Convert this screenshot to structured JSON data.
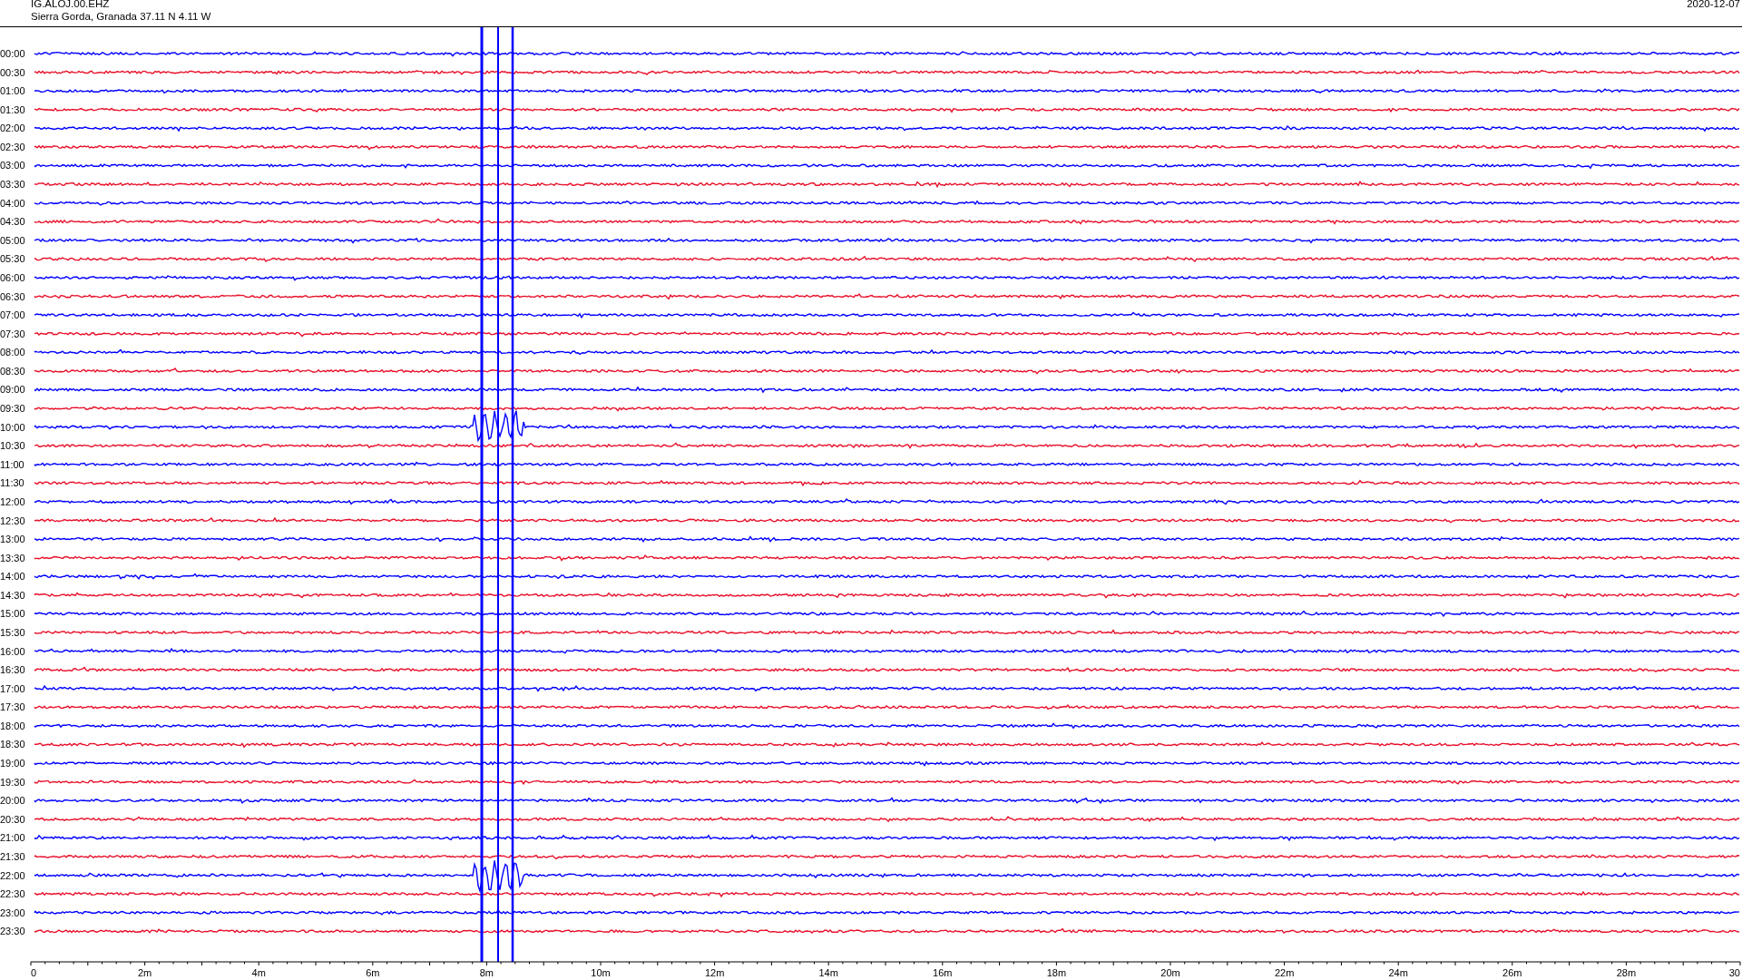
{
  "header": {
    "station": "IG.ALOJ.00.EHZ",
    "location": "Sierra Gorda, Granada  37.11 N 4.11 W",
    "date": "2020-12-07"
  },
  "rows": [
    {
      "time": "00:00",
      "color": "#0000ff"
    },
    {
      "time": "00:30",
      "color": "#e8102a"
    },
    {
      "time": "01:00",
      "color": "#0000ff"
    },
    {
      "time": "01:30",
      "color": "#e8102a"
    },
    {
      "time": "02:00",
      "color": "#0000ff"
    },
    {
      "time": "02:30",
      "color": "#e8102a"
    },
    {
      "time": "03:00",
      "color": "#0000ff"
    },
    {
      "time": "03:30",
      "color": "#e8102a"
    },
    {
      "time": "04:00",
      "color": "#0000ff"
    },
    {
      "time": "04:30",
      "color": "#e8102a"
    },
    {
      "time": "05:00",
      "color": "#0000ff"
    },
    {
      "time": "05:30",
      "color": "#e8102a"
    },
    {
      "time": "06:00",
      "color": "#0000ff"
    },
    {
      "time": "06:30",
      "color": "#e8102a"
    },
    {
      "time": "07:00",
      "color": "#0000ff"
    },
    {
      "time": "07:30",
      "color": "#e8102a"
    },
    {
      "time": "08:00",
      "color": "#0000ff"
    },
    {
      "time": "08:30",
      "color": "#e8102a"
    },
    {
      "time": "09:00",
      "color": "#0000ff"
    },
    {
      "time": "09:30",
      "color": "#e8102a"
    },
    {
      "time": "10:00",
      "color": "#0000ff"
    },
    {
      "time": "10:30",
      "color": "#e8102a"
    },
    {
      "time": "11:00",
      "color": "#0000ff"
    },
    {
      "time": "11:30",
      "color": "#e8102a"
    },
    {
      "time": "12:00",
      "color": "#0000ff"
    },
    {
      "time": "12:30",
      "color": "#e8102a"
    },
    {
      "time": "13:00",
      "color": "#0000ff"
    },
    {
      "time": "13:30",
      "color": "#e8102a"
    },
    {
      "time": "14:00",
      "color": "#0000ff"
    },
    {
      "time": "14:30",
      "color": "#e8102a"
    },
    {
      "time": "15:00",
      "color": "#0000ff"
    },
    {
      "time": "15:30",
      "color": "#e8102a"
    },
    {
      "time": "16:00",
      "color": "#0000ff"
    },
    {
      "time": "16:30",
      "color": "#e8102a"
    },
    {
      "time": "17:00",
      "color": "#0000ff"
    },
    {
      "time": "17:30",
      "color": "#e8102a"
    },
    {
      "time": "18:00",
      "color": "#0000ff"
    },
    {
      "time": "18:30",
      "color": "#e8102a"
    },
    {
      "time": "19:00",
      "color": "#0000ff"
    },
    {
      "time": "19:30",
      "color": "#e8102a"
    },
    {
      "time": "20:00",
      "color": "#0000ff"
    },
    {
      "time": "20:30",
      "color": "#e8102a"
    },
    {
      "time": "21:00",
      "color": "#0000ff"
    },
    {
      "time": "21:30",
      "color": "#e8102a"
    },
    {
      "time": "22:00",
      "color": "#0000ff"
    },
    {
      "time": "22:30",
      "color": "#e8102a"
    },
    {
      "time": "23:00",
      "color": "#0000ff"
    },
    {
      "time": "23:30",
      "color": "#e8102a"
    }
  ],
  "x_axis": {
    "labels": [
      "0",
      "2m",
      "4m",
      "6m",
      "8m",
      "10m",
      "12m",
      "14m",
      "16m",
      "18m",
      "20m",
      "22m",
      "24m",
      "26m",
      "28m",
      "30"
    ]
  }
}
